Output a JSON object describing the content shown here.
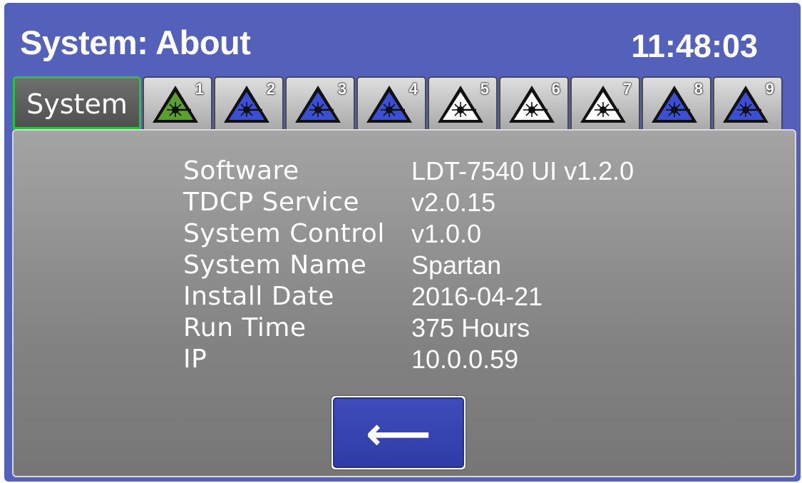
{
  "header": {
    "title": "System: About",
    "clock": "11:48:03"
  },
  "tabs": {
    "system_label": "System",
    "lasers": [
      {
        "number": "1",
        "icon": "laser-warning-icon",
        "fill": "#5aa02c"
      },
      {
        "number": "2",
        "icon": "laser-warning-icon",
        "fill": "#3a4fd6"
      },
      {
        "number": "3",
        "icon": "laser-warning-icon",
        "fill": "#3a4fd6"
      },
      {
        "number": "4",
        "icon": "laser-warning-icon",
        "fill": "#3a4fd6"
      },
      {
        "number": "5",
        "icon": "laser-warning-icon",
        "fill": "#ffffff"
      },
      {
        "number": "6",
        "icon": "laser-warning-icon",
        "fill": "#ffffff"
      },
      {
        "number": "7",
        "icon": "laser-warning-icon",
        "fill": "#ffffff"
      },
      {
        "number": "8",
        "icon": "laser-warning-icon",
        "fill": "#3a4fd6"
      },
      {
        "number": "9",
        "icon": "laser-warning-icon",
        "fill": "#3a4fd6"
      }
    ]
  },
  "about": {
    "rows": [
      {
        "label": "Software",
        "value": "LDT-7540 UI v1.2.0"
      },
      {
        "label": "TDCP Service",
        "value": "v2.0.15"
      },
      {
        "label": "System Control",
        "value": "v1.0.0"
      },
      {
        "label": "System Name",
        "value": "Spartan"
      },
      {
        "label": "Install Date",
        "value": "2016-04-21"
      },
      {
        "label": "Run Time",
        "value": "375 Hours"
      },
      {
        "label": "IP",
        "value": "10.0.0.59"
      }
    ]
  },
  "back_button": {
    "icon": "left-arrow-icon",
    "glyph": "⟵"
  },
  "colors": {
    "frame": "#5361bb",
    "selected_tab_border": "#27c33a",
    "button": "#3e4dbb"
  }
}
